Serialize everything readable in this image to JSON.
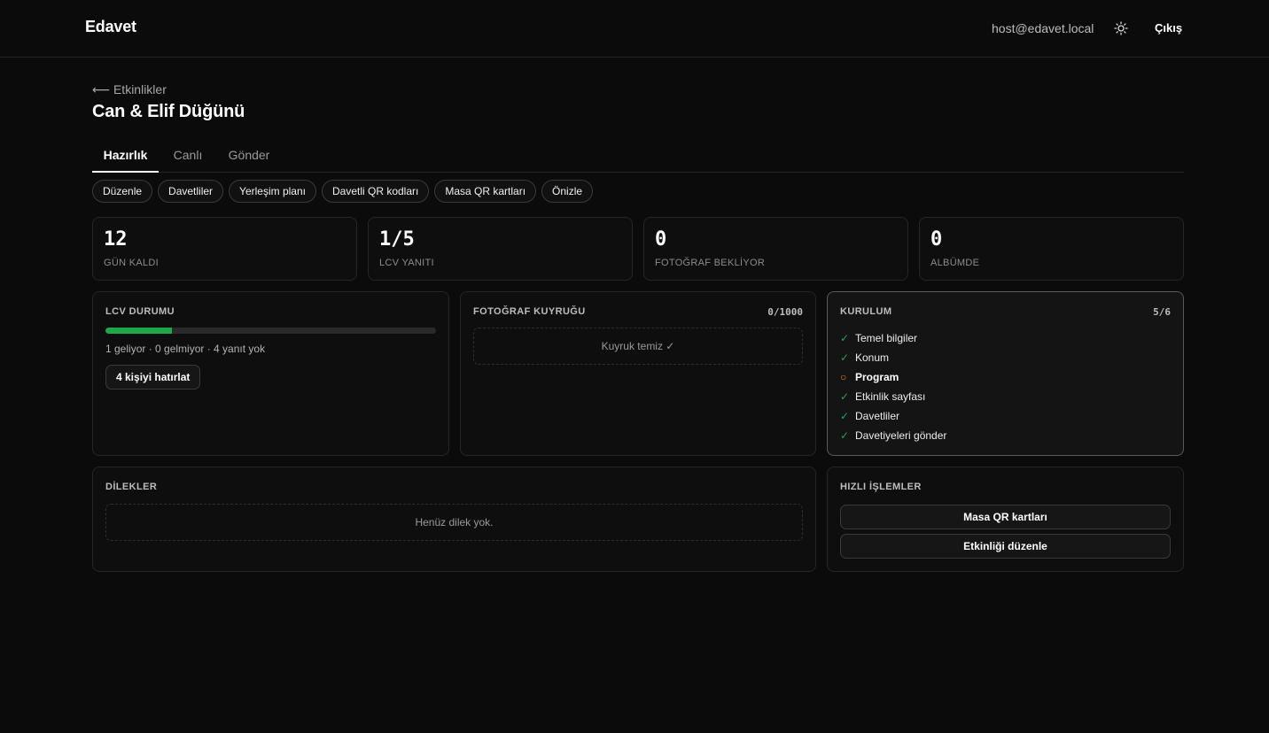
{
  "header": {
    "brand": "Edavet",
    "user_email": "host@edavet.local",
    "logout_label": "Çıkış"
  },
  "breadcrumb": {
    "back_label": "⟵ Etkinlikler"
  },
  "page": {
    "title": "Can & Elif Düğünü"
  },
  "tabs": [
    {
      "label": "Hazırlık",
      "active": true
    },
    {
      "label": "Canlı",
      "active": false
    },
    {
      "label": "Gönder",
      "active": false
    }
  ],
  "subnav": [
    {
      "label": "Düzenle"
    },
    {
      "label": "Davetliler"
    },
    {
      "label": "Yerleşim planı"
    },
    {
      "label": "Davetli QR kodları"
    },
    {
      "label": "Masa QR kartları"
    },
    {
      "label": "Önizle"
    }
  ],
  "stats": [
    {
      "value": "12",
      "label": "GÜN KALDI"
    },
    {
      "value": "1/5",
      "label": "LCV YANITI"
    },
    {
      "value": "0",
      "label": "FOTOĞRAF BEKLİYOR"
    },
    {
      "value": "0",
      "label": "ALBÜMDE"
    }
  ],
  "rsvp": {
    "title": "LCV DURUMU",
    "progress": 0.2,
    "progress_color": "#1fa84a",
    "summary": "1 geliyor · 0 gelmiyor · 4 yanıt yok",
    "remind_label": "4 kişiyi hatırlat"
  },
  "photo_queue": {
    "title": "FOTOĞRAF KUYRUĞU",
    "count": "0/1000",
    "empty_text": "Kuyruk temiz ✓"
  },
  "setup": {
    "title": "KURULUM",
    "count": "5/6",
    "items": [
      {
        "label": "Temel bilgiler",
        "mark": "✓",
        "status": "done"
      },
      {
        "label": "Konum",
        "mark": "✓",
        "status": "done"
      },
      {
        "label": "Program",
        "mark": "○",
        "status": "pending"
      },
      {
        "label": "Etkinlik sayfası",
        "mark": "✓",
        "status": "done"
      },
      {
        "label": "Davetliler",
        "mark": "✓",
        "status": "done"
      },
      {
        "label": "Davetiyeleri gönder",
        "mark": "✓",
        "status": "done"
      }
    ]
  },
  "wishes": {
    "title": "DİLEKLER",
    "empty_text": "Henüz dilek yok."
  },
  "quick_actions": {
    "title": "HIZLI İŞLEMLER",
    "buttons": [
      {
        "label": "Masa QR kartları"
      },
      {
        "label": "Etkinliği düzenle"
      }
    ]
  }
}
